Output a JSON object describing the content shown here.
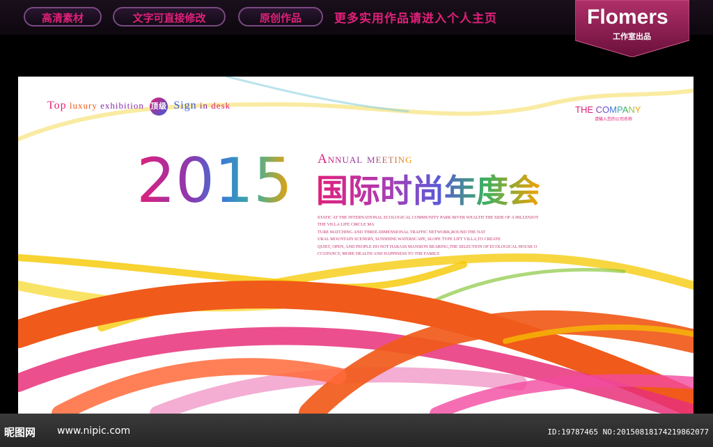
{
  "topbar": {
    "pills": [
      "高清素材",
      "文字可直接修改",
      "原创作品"
    ],
    "promo": "更多实用作品请进入个人主页",
    "logo": {
      "title": "Flomers",
      "subtitle": "工作室出品"
    }
  },
  "poster": {
    "tagline": {
      "w1": "Top",
      "w2": "luxury",
      "w3": "exhibition",
      "badge": "顶级",
      "w4": "Sign",
      "w5": "in",
      "w6": "desk"
    },
    "company": {
      "name": "THE COMPANY",
      "sub": "请输入您的公司名称"
    },
    "year": "2015",
    "annual": "Annual meeting",
    "cn_title": "国际时尚年度会",
    "body_lines": [
      "STATIC AT THE INTERNATIONAL ECOLOGICAL COMMUNITY PARK RIVER WEALTH THE SIDE OF A HILLENJOY",
      "THE VILLA LIFE CIRCLE MA",
      "TURE MATCHING AND THREE-DIMENSIONAL TRAFFIC NETWORK,ROUND THE NAT",
      "URAL MOUNTAIN SCENERY, SUNSHINE WATERSCAPE, SLOPE TYPE LIFT VILLA,TO CREATE",
      "QUIET, OPEN, AND PEOPLE DO NOT HARASS MANSION BEARING,THE SELECTION OF ECOLOGICAL HOUSE O",
      "CCUPANCY, MORE HEALTH AND HAPPINESS TO THE FAMILY."
    ]
  },
  "bottombar": {
    "site_cn": "昵图网",
    "site_url": "www.nipic.com",
    "id_text": "ID:19787465 NO:20150818174219862077"
  },
  "colors": {
    "accent": "#e0207a",
    "purple": "#7a3ab0",
    "orange": "#f05a1a",
    "yellow": "#f5c800"
  }
}
